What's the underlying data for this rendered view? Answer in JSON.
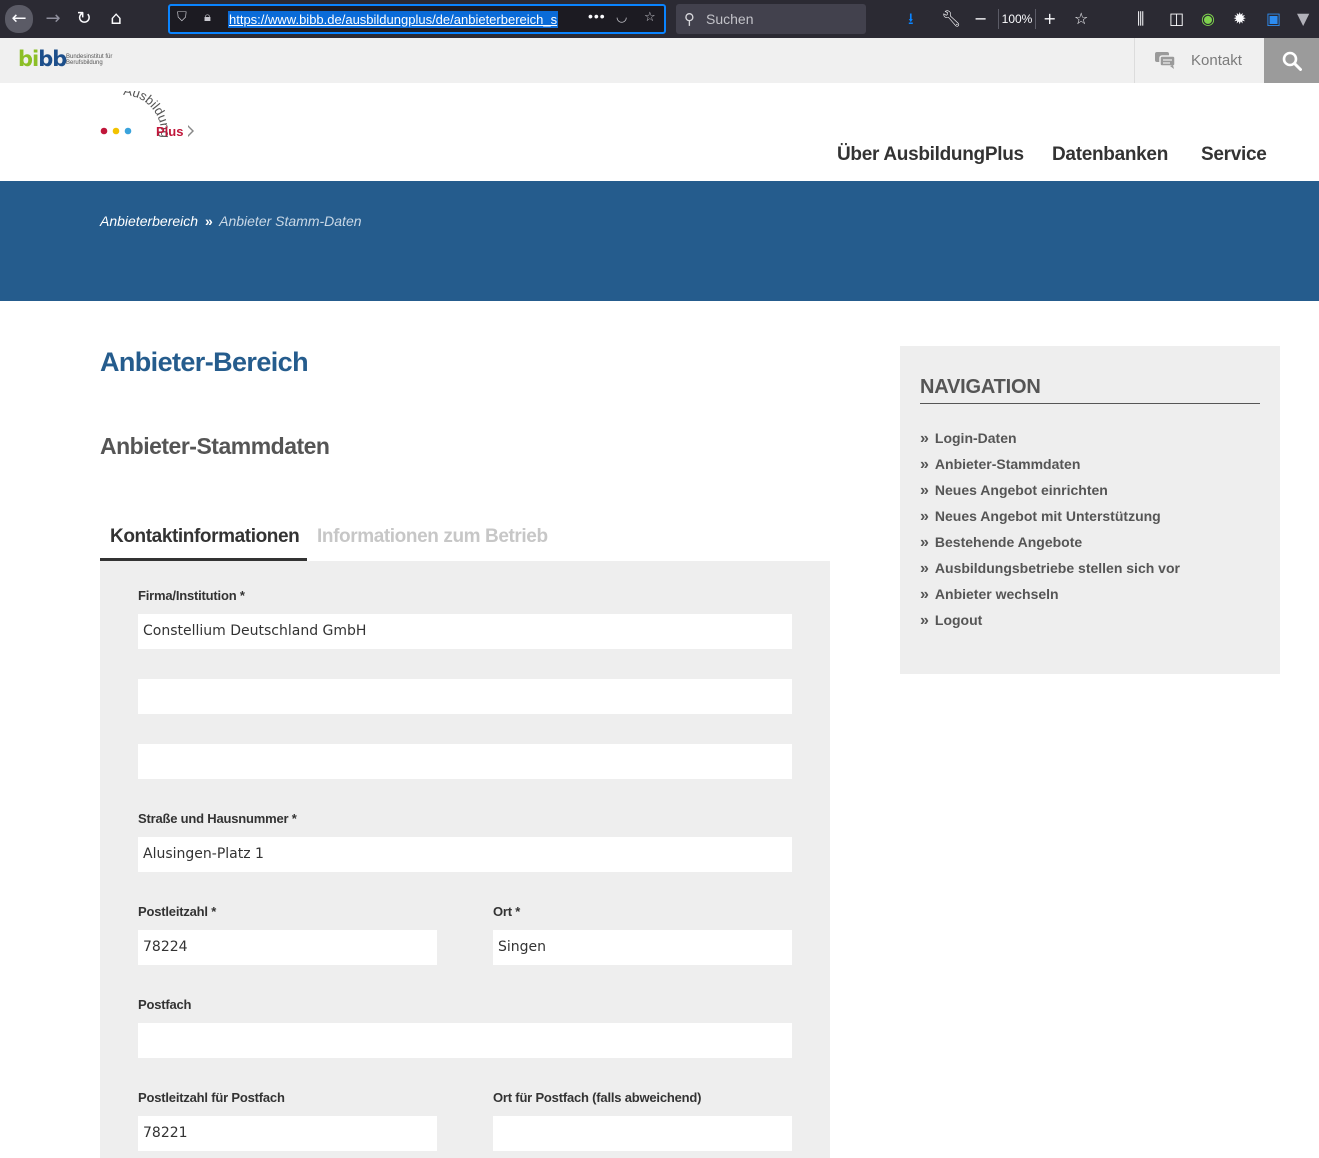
{
  "browser": {
    "url": "https://www.bibb.de/ausbildungplus/de/anbieterbereich_s",
    "search_placeholder": "Suchen",
    "zoom": "100%",
    "more_label": "•••"
  },
  "topbar": {
    "logo_mark": "bibb",
    "logo_subtitle_1": "Bundesinstitut für",
    "logo_subtitle_2": "Berufsbildung",
    "contact_label": "Kontakt"
  },
  "site": {
    "logo_word": "Ausbildung",
    "logo_plus": "Plus",
    "nav": [
      "Über AusbildungPlus",
      "Datenbanken",
      "Service"
    ]
  },
  "breadcrumb": {
    "parent": "Anbieterbereich",
    "separator": "»",
    "current": "Anbieter Stamm-Daten"
  },
  "main": {
    "page_title": "Anbieter-Bereich",
    "section_title": "Anbieter-Stammdaten",
    "tabs": [
      {
        "label": "Kontaktinformationen",
        "active": true
      },
      {
        "label": "Informationen zum Betrieb",
        "active": false
      }
    ]
  },
  "form": {
    "firma_label": "Firma/Institution *",
    "firma_value": "Constellium Deutschland GmbH",
    "firma_line2_value": "",
    "firma_line3_value": "",
    "strasse_label": "Straße und Hausnummer *",
    "strasse_value": "Alusingen-Platz 1",
    "plz_label": "Postleitzahl *",
    "plz_value": "78224",
    "ort_label": "Ort *",
    "ort_value": "Singen",
    "postfach_label": "Postfach",
    "postfach_value": "",
    "plz_postfach_label": "Postleitzahl für Postfach",
    "plz_postfach_value": "78221",
    "ort_postfach_label": "Ort für Postfach (falls abweichend)",
    "ort_postfach_value": ""
  },
  "sidebar": {
    "heading": "NAVIGATION",
    "bullet": "»",
    "items": [
      "Login-Daten",
      "Anbieter-Stammdaten",
      "Neues Angebot einrichten",
      "Neues Angebot mit Unterstützung",
      "Bestehende Angebote",
      "Ausbildungsbetriebe stellen sich vor",
      "Anbieter wechseln",
      "Logout"
    ]
  },
  "colors": {
    "brand_blue": "#255c8d",
    "panel_grey": "#eeeeee",
    "logo_green": "#8cbf26",
    "logo_red": "#c0163a"
  }
}
